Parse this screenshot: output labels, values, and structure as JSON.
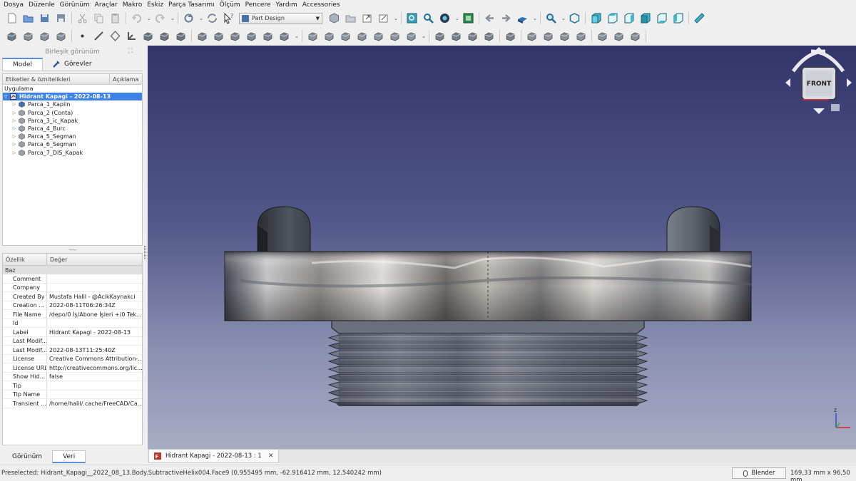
{
  "menu": [
    "Dosya",
    "Düzenle",
    "Görünüm",
    "Araçlar",
    "Makro",
    "Eskiz",
    "Parça Tasarımı",
    "Ölçüm",
    "Pencere",
    "Yardım",
    "Accessories"
  ],
  "toolbar": {
    "workbench": "Part Design"
  },
  "panel": {
    "title": "Birleşik görünüm",
    "tabs": [
      "Model",
      "Görevler"
    ],
    "tree_headers": [
      "Etiketler & öznitelikleri",
      "Açıklama"
    ],
    "tree_root": "Uygulama",
    "tree_document": "Hidrant Kapagi - 2022-08-13",
    "tree_items": [
      "Parca_1_Kaplin",
      "Parca_2 (Conta)",
      "Parca_3_ic_Kapak",
      "Parca_4_Burc",
      "Parca_5_Segman",
      "Parca_6_Segman",
      "Parca_7_DIS_Kapak"
    ],
    "prop_headers": [
      "Özellik",
      "Değer"
    ],
    "prop_group": "Baz",
    "properties": [
      {
        "name": "Comment",
        "value": ""
      },
      {
        "name": "Company",
        "value": ""
      },
      {
        "name": "Created By",
        "value": "Mustafa Halil - @AcikKaynakci"
      },
      {
        "name": "Creation ...",
        "value": "2022-08-11T06:26:34Z"
      },
      {
        "name": "File Name",
        "value": "/depo/0 İş/Abone İşleri +/0 Tek..."
      },
      {
        "name": "Id",
        "value": ""
      },
      {
        "name": "Label",
        "value": "Hidrant Kapagi - 2022-08-13"
      },
      {
        "name": "Last Modif...",
        "value": ""
      },
      {
        "name": "Last Modif...",
        "value": "2022-08-13T11:25:40Z"
      },
      {
        "name": "License",
        "value": "Creative Commons Attribution-..."
      },
      {
        "name": "License URL",
        "value": "http://creativecommons.org/lic..."
      },
      {
        "name": "Show Hid...",
        "value": "false"
      },
      {
        "name": "Tip",
        "value": ""
      },
      {
        "name": "Tip Name",
        "value": ""
      },
      {
        "name": "Transient ...",
        "value": "/home/halil/.cache/FreeCAD/Ca..."
      }
    ],
    "bottom_tabs": [
      "Görünüm",
      "Veri"
    ]
  },
  "viewport": {
    "navcube_face": "FRONT",
    "axis_label": "z"
  },
  "document_tab": {
    "label": "Hidrant Kapagi - 2022-08-13 : 1",
    "close": "✕"
  },
  "status": {
    "text": "Preselected: Hidrant_Kapagi__2022_08_13.Body.SubtractiveHelix004.Face9 (0.955495 mm, -62.916412 mm, 12.540242 mm)",
    "navigation_style": "Blender",
    "dimensions": "169,33 mm x 96,50 mm"
  },
  "colors": {
    "accent": "#3d82e5",
    "viewport_top": "#32346a",
    "viewport_bottom": "#a8abc4"
  }
}
